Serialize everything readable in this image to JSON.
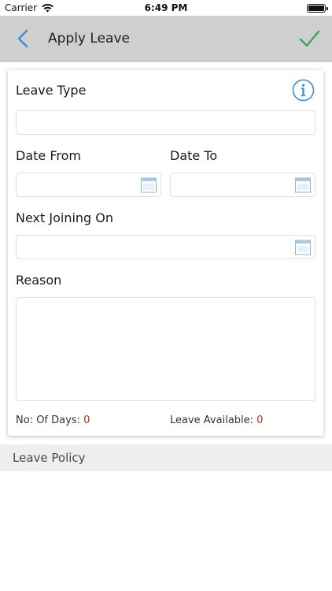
{
  "status": {
    "carrier": "Carrier",
    "time": "6:49 PM",
    "battery_level": 1.0
  },
  "header": {
    "title": "Apply Leave",
    "back_icon": "chevron-left-icon",
    "done_icon": "checkmark-icon"
  },
  "form": {
    "leave_type_label": "Leave Type",
    "leave_type_value": "",
    "date_from_label": "Date From",
    "date_from_value": "",
    "date_to_label": "Date To",
    "date_to_value": "",
    "next_joining_label": "Next Joining On",
    "next_joining_value": "",
    "reason_label": "Reason",
    "reason_value": "",
    "days_label": "No: Of Days:",
    "days_value": "0",
    "available_label": "Leave Available:",
    "available_value": "0"
  },
  "policy": {
    "label": "Leave Policy"
  },
  "colors": {
    "accent_blue": "#3a8fd6",
    "accent_green": "#3aa655",
    "value_red": "#b0341c",
    "header_bg": "#cfcfcf"
  }
}
